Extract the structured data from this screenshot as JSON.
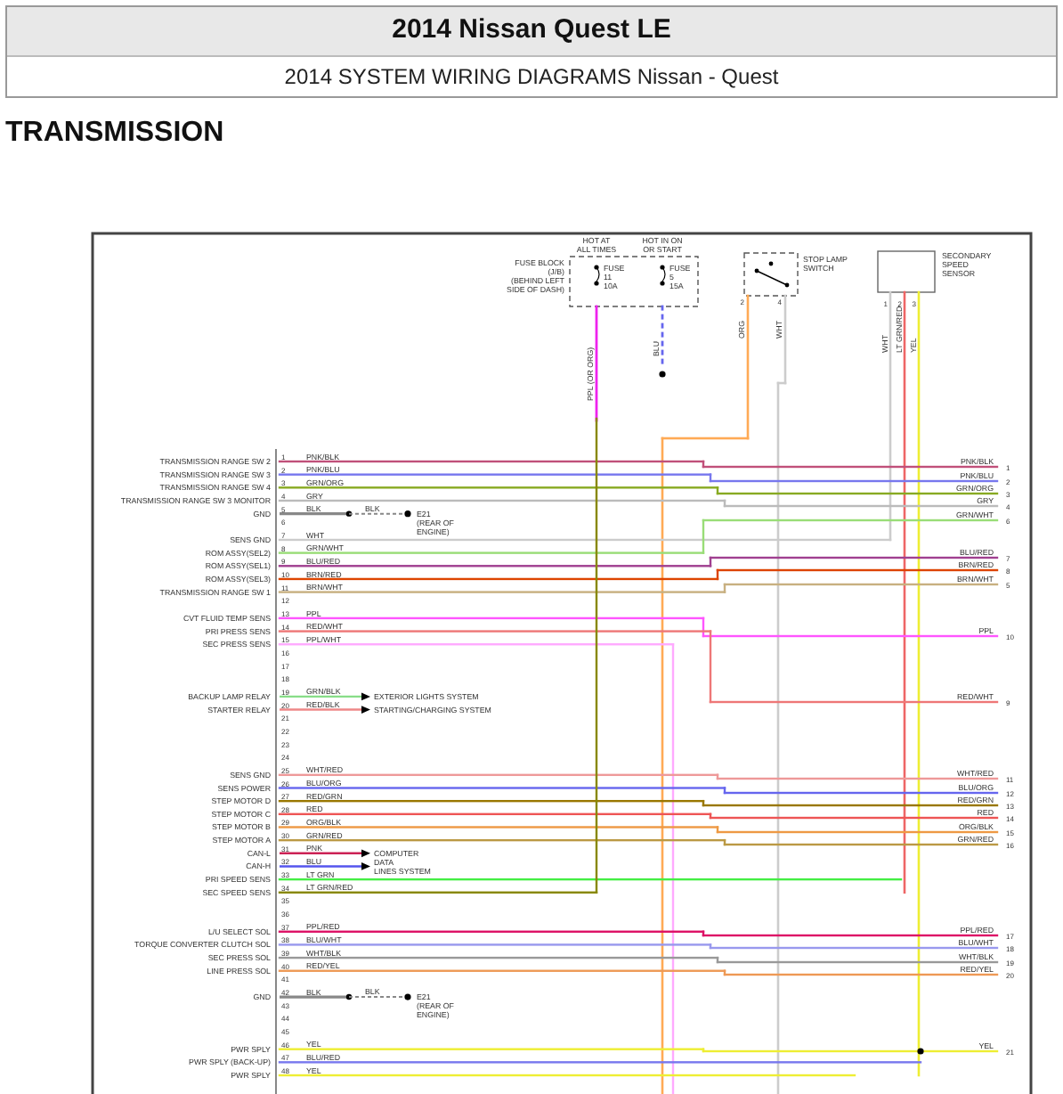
{
  "header": {
    "title": "2014 Nissan Quest LE",
    "subtitle": "2014 SYSTEM WIRING DIAGRAMS Nissan - Quest"
  },
  "section_title": "TRANSMISSION",
  "diagram": {
    "fuse_block": {
      "label_lines": [
        "FUSE BLOCK",
        "(J/B)",
        "(BEHIND LEFT",
        "SIDE OF DASH)"
      ],
      "fuses": [
        {
          "caption_lines": [
            "HOT AT",
            "ALL TIMES"
          ],
          "label_lines": [
            "FUSE",
            "11",
            "10A"
          ],
          "wire": "PPL (OR ORG)",
          "color": "#ee22ee"
        },
        {
          "caption_lines": [
            "HOT IN ON",
            "OR START"
          ],
          "label_lines": [
            "FUSE",
            "5",
            "15A"
          ],
          "wire": "BLU",
          "color": "#6666ee"
        }
      ]
    },
    "stop_lamp_switch": {
      "label_lines": [
        "STOP LAMP",
        "SWITCH"
      ],
      "pins": [
        {
          "pin": "2",
          "wire": "ORG",
          "color": "#ffaa55"
        },
        {
          "pin": "4",
          "wire": "WHT",
          "color": "#cccccc"
        }
      ]
    },
    "sensor": {
      "label_lines": [
        "SECONDARY",
        "SPEED",
        "SENSOR"
      ],
      "pins": [
        {
          "pin": "1",
          "wire": "WHT",
          "color": "#cccccc"
        },
        {
          "pin": "2",
          "wire": "LT GRN/RED",
          "color": "#ee6666"
        },
        {
          "pin": "3",
          "wire": "YEL",
          "color": "#eeee33"
        }
      ]
    },
    "pins": [
      {
        "pin": "1",
        "label": "TRANSMISSION RANGE SW 2",
        "wire": "PNK/BLK",
        "color": "#c0507a",
        "kind": "through",
        "end": {
          "label": "PNK/BLK",
          "pin": "1"
        }
      },
      {
        "pin": "2",
        "label": "TRANSMISSION RANGE SW 3",
        "wire": "PNK/BLU",
        "color": "#7777ee",
        "kind": "through",
        "end": {
          "label": "PNK/BLU",
          "pin": "2"
        }
      },
      {
        "pin": "3",
        "label": "TRANSMISSION RANGE SW 4",
        "wire": "GRN/ORG",
        "color": "#88aa22",
        "kind": "through",
        "end": {
          "label": "GRN/ORG",
          "pin": "3"
        }
      },
      {
        "pin": "4",
        "label": "TRANSMISSION RANGE SW 3 MONITOR",
        "wire": "GRY",
        "color": "#bbbbbb",
        "kind": "through",
        "end": {
          "label": "GRY",
          "pin": "4"
        }
      },
      {
        "pin": "5",
        "label": "GND",
        "wire": "BLK",
        "color": "#888888",
        "kind": "ground",
        "ground": {
          "wire": "BLK",
          "lines": [
            "E21",
            "(REAR OF",
            "ENGINE)"
          ]
        }
      },
      {
        "pin": "6",
        "kind": "none"
      },
      {
        "pin": "7",
        "label": "SENS GND",
        "wire": "WHT",
        "color": "#cccccc",
        "kind": "up"
      },
      {
        "pin": "8",
        "label": "ROM ASSY(SEL2)",
        "wire": "GRN/WHT",
        "color": "#99dd77",
        "kind": "through",
        "end": {
          "label": "GRN/WHT",
          "pin": "6"
        }
      },
      {
        "pin": "9",
        "label": "ROM ASSY(SEL1)",
        "wire": "BLU/RED",
        "color": "#a04090",
        "kind": "through",
        "end": {
          "label": "BLU/RED",
          "pin": "7"
        }
      },
      {
        "pin": "10",
        "label": "ROM ASSY(SEL3)",
        "wire": "BRN/RED",
        "color": "#dd4400",
        "kind": "through",
        "end": {
          "label": "BRN/RED",
          "pin": "8"
        }
      },
      {
        "pin": "11",
        "label": "TRANSMISSION RANGE SW 1",
        "wire": "BRN/WHT",
        "color": "#c8b080",
        "kind": "through",
        "end": {
          "label": "BRN/WHT",
          "pin": "5"
        }
      },
      {
        "pin": "12",
        "kind": "none"
      },
      {
        "pin": "13",
        "label": "CVT FLUID TEMP SENS",
        "wire": "PPL",
        "color": "#ff55ff",
        "kind": "through",
        "end": {
          "label": "PPL",
          "pin": "10"
        }
      },
      {
        "pin": "14",
        "label": "PRI PRESS SENS",
        "wire": "RED/WHT",
        "color": "#ee7777",
        "kind": "through",
        "end": {
          "label": "RED/WHT",
          "pin": "9"
        }
      },
      {
        "pin": "15",
        "label": "SEC PRESS SENS",
        "wire": "PPL/WHT",
        "color": "#ffaaff",
        "kind": "down"
      },
      {
        "pin": "16",
        "kind": "none"
      },
      {
        "pin": "17",
        "kind": "none"
      },
      {
        "pin": "18",
        "kind": "none"
      },
      {
        "pin": "19",
        "label": "BACKUP LAMP RELAY",
        "wire": "GRN/BLK",
        "color": "#88dd88",
        "kind": "arrow",
        "target": "EXTERIOR LIGHTS SYSTEM"
      },
      {
        "pin": "20",
        "label": "STARTER RELAY",
        "wire": "RED/BLK",
        "color": "#ee8888",
        "kind": "arrow",
        "target": "STARTING/CHARGING SYSTEM"
      },
      {
        "pin": "21",
        "kind": "none"
      },
      {
        "pin": "22",
        "kind": "none"
      },
      {
        "pin": "23",
        "kind": "none"
      },
      {
        "pin": "24",
        "kind": "none"
      },
      {
        "pin": "25",
        "label": "SENS GND",
        "wire": "WHT/RED",
        "color": "#ee9999",
        "kind": "through",
        "end": {
          "label": "WHT/RED",
          "pin": "11"
        }
      },
      {
        "pin": "26",
        "label": "SENS POWER",
        "wire": "BLU/ORG",
        "color": "#6666ee",
        "kind": "through",
        "end": {
          "label": "BLU/ORG",
          "pin": "12"
        }
      },
      {
        "pin": "27",
        "label": "STEP MOTOR D",
        "wire": "RED/GRN",
        "color": "#997700",
        "kind": "through",
        "end": {
          "label": "RED/GRN",
          "pin": "13"
        }
      },
      {
        "pin": "28",
        "label": "STEP MOTOR C",
        "wire": "RED",
        "color": "#ee5555",
        "kind": "through",
        "end": {
          "label": "RED",
          "pin": "14"
        }
      },
      {
        "pin": "29",
        "label": "STEP MOTOR B",
        "wire": "ORG/BLK",
        "color": "#ee9944",
        "kind": "through",
        "end": {
          "label": "ORG/BLK",
          "pin": "15"
        }
      },
      {
        "pin": "30",
        "label": "STEP MOTOR A",
        "wire": "GRN/RED",
        "color": "#bb9944",
        "kind": "through",
        "end": {
          "label": "GRN/RED",
          "pin": "16"
        }
      },
      {
        "pin": "31",
        "label": "CAN-L",
        "wire": "PNK",
        "color": "#cc2255",
        "kind": "arrow",
        "target": "COMPUTER DATA LINES SYSTEM"
      },
      {
        "pin": "32",
        "label": "CAN-H",
        "wire": "BLU",
        "color": "#5555ee",
        "kind": "arrow"
      },
      {
        "pin": "33",
        "label": "PRI SPEED SENS",
        "wire": "LT GRN",
        "color": "#44ee44",
        "kind": "up"
      },
      {
        "pin": "34",
        "label": "SEC SPEED SENS",
        "wire": "LT GRN/RED",
        "color": "#888800",
        "kind": "up"
      },
      {
        "pin": "35",
        "kind": "none"
      },
      {
        "pin": "36",
        "kind": "none"
      },
      {
        "pin": "37",
        "label": "L/U SELECT SOL",
        "wire": "PPL/RED",
        "color": "#dd1166",
        "kind": "through",
        "end": {
          "label": "PPL/RED",
          "pin": "17"
        }
      },
      {
        "pin": "38",
        "label": "TORQUE CONVERTER CLUTCH SOL",
        "wire": "BLU/WHT",
        "color": "#9999ee",
        "kind": "through",
        "end": {
          "label": "BLU/WHT",
          "pin": "18"
        }
      },
      {
        "pin": "39",
        "label": "SEC PRESS SOL",
        "wire": "WHT/BLK",
        "color": "#999999",
        "kind": "through",
        "end": {
          "label": "WHT/BLK",
          "pin": "19"
        }
      },
      {
        "pin": "40",
        "label": "LINE PRESS SOL",
        "wire": "RED/YEL",
        "color": "#ee9955",
        "kind": "through",
        "end": {
          "label": "RED/YEL",
          "pin": "20"
        }
      },
      {
        "pin": "41",
        "kind": "none"
      },
      {
        "pin": "42",
        "label": "GND",
        "wire": "BLK",
        "color": "#888888",
        "kind": "ground",
        "ground": {
          "wire": "BLK",
          "lines": [
            "E21",
            "(REAR OF",
            "ENGINE)"
          ]
        }
      },
      {
        "pin": "43",
        "kind": "none"
      },
      {
        "pin": "44",
        "kind": "none"
      },
      {
        "pin": "45",
        "kind": "none"
      },
      {
        "pin": "46",
        "label": "PWR SPLY",
        "wire": "YEL",
        "color": "#eeee33",
        "kind": "through",
        "end": {
          "label": "YEL",
          "pin": "21"
        }
      },
      {
        "pin": "47",
        "label": "PWR SPLY (BACK-UP)",
        "wire": "BLU/RED",
        "color": "#7777ee",
        "kind": "up"
      },
      {
        "pin": "48",
        "label": "PWR SPLY",
        "wire": "YEL",
        "color": "#eeee33",
        "kind": "up"
      }
    ]
  }
}
